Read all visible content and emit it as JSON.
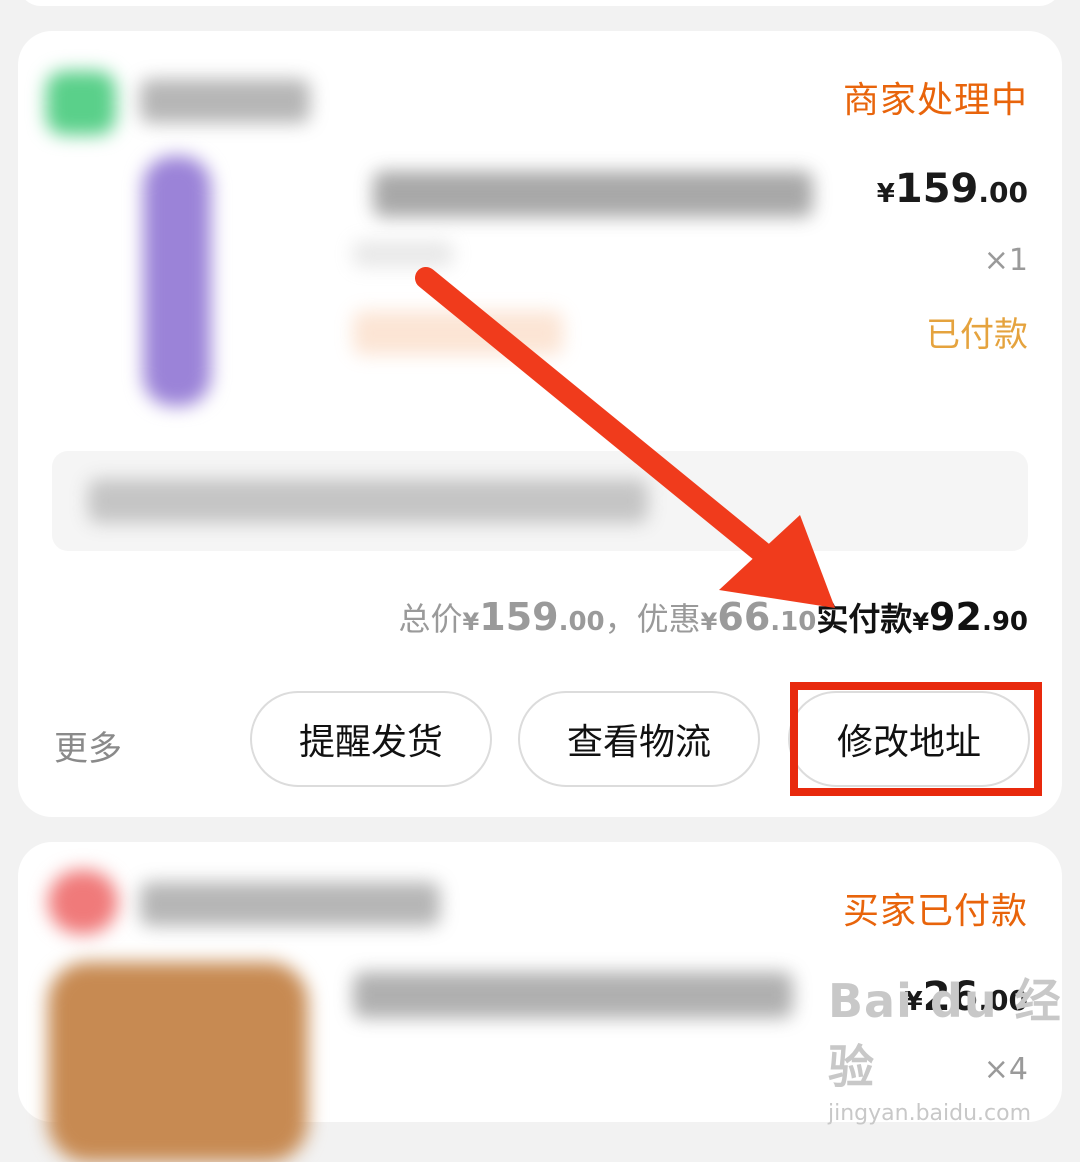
{
  "order1": {
    "status": "商家处理中",
    "price": {
      "symbol": "¥",
      "integer": "159",
      "decimal": ".00"
    },
    "quantity": "×1",
    "payment_status": "已付款",
    "summary": {
      "total_label": "总价",
      "total_symbol": "¥",
      "total_integer": "159",
      "total_decimal": ".00",
      "separator": "，",
      "discount_label": "优惠",
      "discount_symbol": "¥",
      "discount_integer": "66",
      "discount_decimal": ".10",
      "paid_label": "实付款",
      "paid_symbol": "¥",
      "paid_integer": "92",
      "paid_decimal": ".90"
    },
    "more_label": "更多",
    "buttons": {
      "remind_ship": "提醒发货",
      "view_logistics": "查看物流",
      "change_address": "修改地址"
    }
  },
  "order2": {
    "status": "买家已付款",
    "price": {
      "symbol": "¥",
      "integer": "26",
      "decimal": ".00"
    },
    "quantity": "×4"
  },
  "watermark": {
    "brand": "Bai du 经验",
    "url": "jingyan.baidu.com"
  },
  "colors": {
    "status_orange": "#e8640b",
    "paid_gold": "#e5a33e",
    "highlight_red": "#e8290d",
    "arrow_red": "#f03b1c"
  }
}
